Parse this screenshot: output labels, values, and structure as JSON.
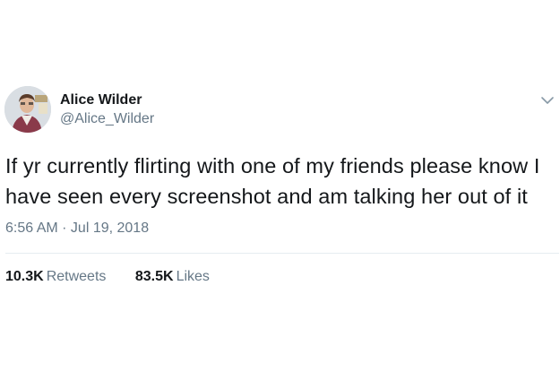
{
  "tweet": {
    "author_name": "Alice Wilder",
    "author_handle": "@Alice_Wilder",
    "text": "If yr currently flirting with one of my friends please know I have seen every screenshot and am talking her out of it",
    "timestamp": "6:56 AM · Jul 19, 2018",
    "retweets_count": "10.3K",
    "retweets_label": "Retweets",
    "likes_count": "83.5K",
    "likes_label": "Likes",
    "menu_icon": "chevron-down-icon",
    "avatar": "user-avatar"
  },
  "colors": {
    "primary_text": "#14171a",
    "secondary_text": "#657786",
    "divider": "#e6ecf0",
    "accent": "#1da1f2"
  }
}
